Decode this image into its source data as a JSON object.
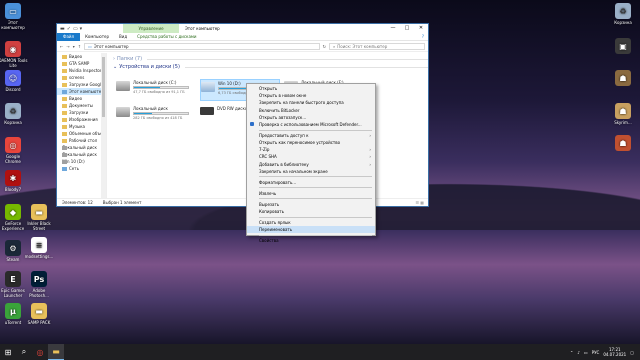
{
  "desktop_icons_left": [
    {
      "label": "Этот компьютер",
      "icon": "computer-icon",
      "color": "#4a90d9",
      "glyph": "▭"
    },
    {
      "label": "DAEMON Tools Lite",
      "icon": "daemon-tools-icon",
      "color": "#d04040",
      "glyph": "◉"
    },
    {
      "label": "Discord",
      "icon": "discord-icon",
      "color": "#5865f2",
      "glyph": "☺"
    },
    {
      "label": "Корзина",
      "icon": "recycle-bin-icon",
      "color": "#9ab0c8",
      "glyph": "♻"
    },
    {
      "label": "Google Chrome",
      "icon": "chrome-icon",
      "color": "#e8453c",
      "glyph": "◎"
    },
    {
      "label": "Bloody7",
      "icon": "bloody-icon",
      "color": "#b01010",
      "glyph": "✱"
    },
    {
      "label": "GeForce Experience",
      "icon": "geforce-icon",
      "color": "#76b900",
      "glyph": "◆"
    },
    {
      "label": "Steam",
      "icon": "steam-icon",
      "color": "#1b2838",
      "glyph": "⚙"
    },
    {
      "label": "Epic Games Launcher",
      "icon": "epic-games-icon",
      "color": "#2a2a2a",
      "glyph": "E"
    },
    {
      "label": "uTorrent",
      "icon": "utorrent-icon",
      "color": "#3aa33a",
      "glyph": "µ"
    }
  ],
  "desktop_icons_mid": [
    {
      "label": "Inkler Black Street",
      "icon": "folder-icon",
      "color": "#e8c05a",
      "glyph": "▬"
    },
    {
      "label": "modsettings...",
      "icon": "file-icon",
      "color": "#ffffff",
      "glyph": "≡"
    },
    {
      "label": "Adobe Photosh...",
      "icon": "photoshop-icon",
      "color": "#001e36",
      "glyph": "Ps"
    },
    {
      "label": "SAMP PACK",
      "icon": "folder-icon",
      "color": "#e8c05a",
      "glyph": "▬"
    }
  ],
  "desktop_icons_right": [
    {
      "label": "Корзина",
      "icon": "recycle-bin-icon",
      "color": "#9ab0c8",
      "glyph": "♻"
    },
    {
      "label": "",
      "icon": "app-icon",
      "color": "#3a3a3a",
      "glyph": "▣"
    },
    {
      "label": "",
      "icon": "game-icon",
      "color": "#8a6a40",
      "glyph": "☗"
    },
    {
      "label": "Skyrim...",
      "icon": "game-icon",
      "color": "#c8a060",
      "glyph": "☗"
    },
    {
      "label": "",
      "icon": "game-icon",
      "color": "#c05030",
      "glyph": "☗"
    }
  ],
  "explorer": {
    "title": "Этот компьютер",
    "manage_tab": "Управление",
    "ribbon_tabs": [
      "Файл",
      "Компьютер",
      "Вид",
      "Средства работы с дисками"
    ],
    "address": "Этот компьютер",
    "search_placeholder": "Поиск: Этот компьютер",
    "nav_items": [
      {
        "label": "Видео",
        "icon": "folder"
      },
      {
        "label": "GTA SAMP",
        "icon": "folder"
      },
      {
        "label": "Nvidia Inspector",
        "icon": "folder"
      },
      {
        "label": "screens",
        "icon": "folder"
      },
      {
        "label": "Загрузки Google",
        "icon": "folder"
      },
      {
        "label": "Этот компьютер",
        "icon": "computer",
        "selected": true
      },
      {
        "label": "Видео",
        "icon": "folder"
      },
      {
        "label": "Документы",
        "icon": "folder"
      },
      {
        "label": "Загрузки",
        "icon": "folder"
      },
      {
        "label": "Изображения",
        "icon": "folder"
      },
      {
        "label": "Музыка",
        "icon": "folder"
      },
      {
        "label": "Объемные объекты",
        "icon": "folder"
      },
      {
        "label": "Рабочий стол",
        "icon": "folder"
      },
      {
        "label": "Локальный диск",
        "icon": "drive"
      },
      {
        "label": "Локальный диск",
        "icon": "drive"
      },
      {
        "label": "Win 10 (D:)",
        "icon": "drive"
      },
      {
        "label": "Сеть",
        "icon": "network"
      }
    ],
    "group_folders": "Папки (7)",
    "group_devices": "Устройства и диски (5)",
    "drives": [
      {
        "name": "Локальный диск (C:)",
        "free": "47,7 ГБ свободно из 91,1 ГБ",
        "used_fraction": 0.48,
        "kind": "hdd"
      },
      {
        "name": "Win 10 (D:)",
        "free": "6,73 ГБ свободно из ...",
        "used_fraction": 0.8,
        "kind": "win",
        "selected": true
      },
      {
        "name": "Локальный диск (F:)",
        "free": "",
        "used_fraction": 0.3,
        "kind": "hdd"
      },
      {
        "name": "Локальный диск",
        "free": "282 ГБ свободно из 418 ГБ",
        "used_fraction": 0.33,
        "kind": "hdd"
      },
      {
        "name": "DVD RW дисковод",
        "free": "",
        "used_fraction": 0,
        "kind": "dvd"
      }
    ],
    "status_items": "Элементов: 12",
    "status_selected": "Выбран 1 элемент"
  },
  "context_menu": {
    "groups": [
      [
        "Открыть",
        "Открыть в новом окне",
        "Закрепить на панели быстрого доступа",
        "Включить BitLocker",
        "Открыть автозапуск...",
        "Проверка с использованием Microsoft Defender..."
      ],
      [
        "Предоставить доступ к",
        "Открыть как переносимое устройство",
        "7-Zip",
        "CRC SHA",
        "Добавить в библиотеку",
        "Закрепить на начальном экране"
      ],
      [
        "Форматировать..."
      ],
      [
        "Извлечь"
      ],
      [
        "Вырезать",
        "Копировать"
      ],
      [
        "Создать ярлык",
        "Переименовать"
      ],
      [
        "Свойства"
      ]
    ],
    "submenu_items": [
      "Предоставить доступ к",
      "7-Zip",
      "CRC SHA",
      "Добавить в библиотеку"
    ],
    "highlighted": "Переименовать"
  },
  "taskbar": {
    "buttons": [
      "windows-start-icon",
      "search-icon",
      "chrome-icon",
      "file-explorer-icon"
    ],
    "tray_lang": "РУС",
    "time": "17:21",
    "date": "04.07.2021"
  }
}
